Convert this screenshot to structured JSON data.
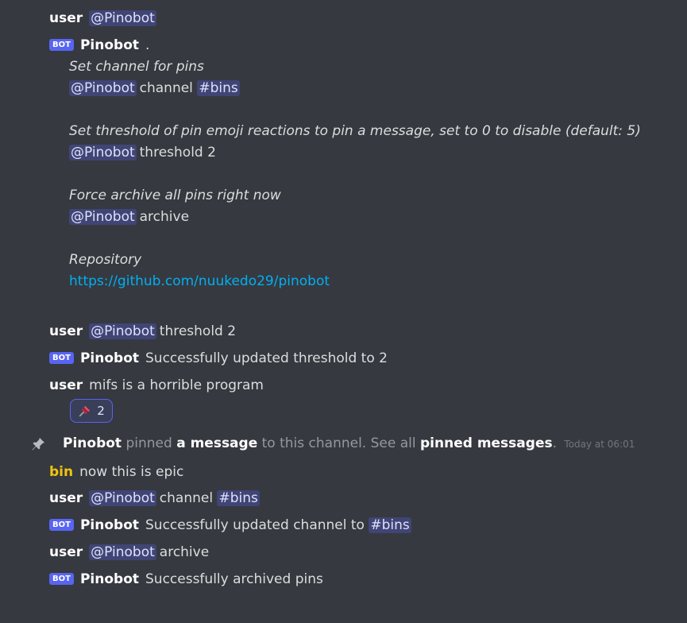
{
  "messages": {
    "m1": {
      "author": "user",
      "mention": "@Pinobot"
    },
    "m2": {
      "author": "Pinobot",
      "tag": "BOT",
      "suffix": ".",
      "help": {
        "channel_desc": "Set channel for pins",
        "channel_mention": "@Pinobot",
        "channel_cmd": "channel",
        "channel_arg": "#bins",
        "threshold_desc": "Set threshold of pin emoji reactions to pin a message, set to 0 to disable (default: 5)",
        "threshold_mention": "@Pinobot",
        "threshold_cmd": "threshold 2",
        "archive_desc": "Force archive all pins right now",
        "archive_mention": "@Pinobot",
        "archive_cmd": "archive",
        "repo_desc": "Repository",
        "repo_link": "https://github.com/nuukedo29/pinobot"
      }
    },
    "m3": {
      "author": "user",
      "mention": "@Pinobot",
      "text": "threshold 2"
    },
    "m4": {
      "author": "Pinobot",
      "tag": "BOT",
      "text": "Successfully updated threshold to 2"
    },
    "m5": {
      "author": "user",
      "text": "mifs is a horrible program",
      "reaction_count": "2",
      "reaction_emoji": "pushpin"
    },
    "sys": {
      "actor": "Pinobot",
      "text1": "pinned",
      "link1": "a message",
      "text2": "to this channel. See all",
      "link2": "pinned messages",
      "text3": ".",
      "timestamp": "Today at 06:01"
    },
    "m6": {
      "author": "bin",
      "text": "now this is epic"
    },
    "m7": {
      "author": "user",
      "mention": "@Pinobot",
      "text": "channel",
      "channel": "#bins"
    },
    "m8": {
      "author": "Pinobot",
      "tag": "BOT",
      "text": "Successfully updated channel to",
      "channel": "#bins"
    },
    "m9": {
      "author": "user",
      "mention": "@Pinobot",
      "text": "archive"
    },
    "m10": {
      "author": "Pinobot",
      "tag": "BOT",
      "text": "Successfully archived pins"
    }
  },
  "colors": {
    "background": "#36393f",
    "mention_bg": "rgba(88,101,242,0.3)",
    "bot_tag": "#5865f2",
    "link": "#00aff4",
    "bin_user": "#f1c40f"
  }
}
